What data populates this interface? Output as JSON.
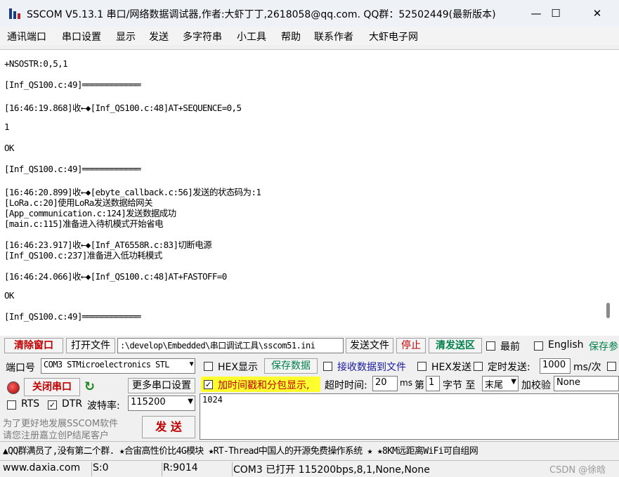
{
  "window": {
    "title": "SSCOM V5.13.1 串口/网络数据调试器,作者:大虾丁丁,2618058@qq.com. QQ群：52502449(最新版本)",
    "minimize": "—",
    "maximize": "☐",
    "close": "✕"
  },
  "menu": [
    "通讯端口",
    "串口设置",
    "显示",
    "发送",
    "多字符串",
    "小工具",
    "帮助",
    "联系作者",
    "大虾电子网"
  ],
  "output_lines": [
    "+NSOSTR:0,5,1",
    "[Inf_QS100.c:49]════════════",
    "[16:46:19.868]收←◆[Inf_QS100.c:48]AT+SEQUENCE=0,5",
    "1",
    "OK",
    "[Inf_QS100.c:49]════════════",
    "[16:46:20.899]收←◆[ebyte_callback.c:56]发送的状态码为:1",
    "[LoRa.c:20]使用LoRa发送数据给网关",
    "[App_communication.c:124]发送数据成功",
    "[main.c:115]准备进入待机模式开始省电",
    "[16:46:23.917]收←◆[Inf_AT6558R.c:83]切断电源",
    "[Inf_QS100.c:237]准备进入低功耗模式",
    "[16:46:24.066]收←◆[Inf_QS100.c:48]AT+FASTOFF=0",
    "OK",
    "[Inf_QS100.c:49]════════════"
  ],
  "toolbar": {
    "clear_window": "清除窗口",
    "open_file": "打开文件",
    "file_path": ":\\develop\\Embedded\\串口调试工具\\sscom51.ini",
    "send_file": "发送文件",
    "stop": "停止",
    "clear_send": "清发送区",
    "last": "最前",
    "english": "English",
    "save_params": "保存参"
  },
  "port": {
    "port_label": "端口号",
    "port_value": "COM3 STMicroelectronics STL",
    "close_port": "关闭串口",
    "more_settings": "更多串口设置",
    "rts": "RTS",
    "dtr": "DTR",
    "baud_label": "波特率:",
    "baud_value": "115200",
    "promo1": "为了更好地发展SSCOM软件",
    "promo2": "请您注册嘉立创P结尾客户",
    "send": "发  送"
  },
  "options": {
    "hex_display": "HEX显示",
    "save_data": "保存数据",
    "receive_to_file": "接收数据到文件",
    "hex_send": "HEX发送",
    "timed_send": "定时发送:",
    "interval": "1000",
    "interval_unit": "ms/次",
    "timestamp": "加时间戳和分包显示,",
    "timeout_label": "超时时间:",
    "timeout": "20",
    "ms": "ms",
    "byte_from_label": "第",
    "byte_from": "1",
    "byte_label": "字节 至",
    "byte_to": "末尾",
    "checksum_label": "加校验",
    "checksum": "None"
  },
  "send_text": "1024",
  "ticker": "▲QQ群满员了,没有第二个群. ★合宙高性价比4G模块 ★RT-Thread中国人的开源免费操作系统 ★ ★8KM远距离WiFi可自组网",
  "status": {
    "site": "www.daxia.com",
    "s": "S:0",
    "r": "R:9014",
    "port_status": "COM3 已打开  115200bps,8,1,None,None",
    "watermark": "CSDN @徐晗"
  }
}
